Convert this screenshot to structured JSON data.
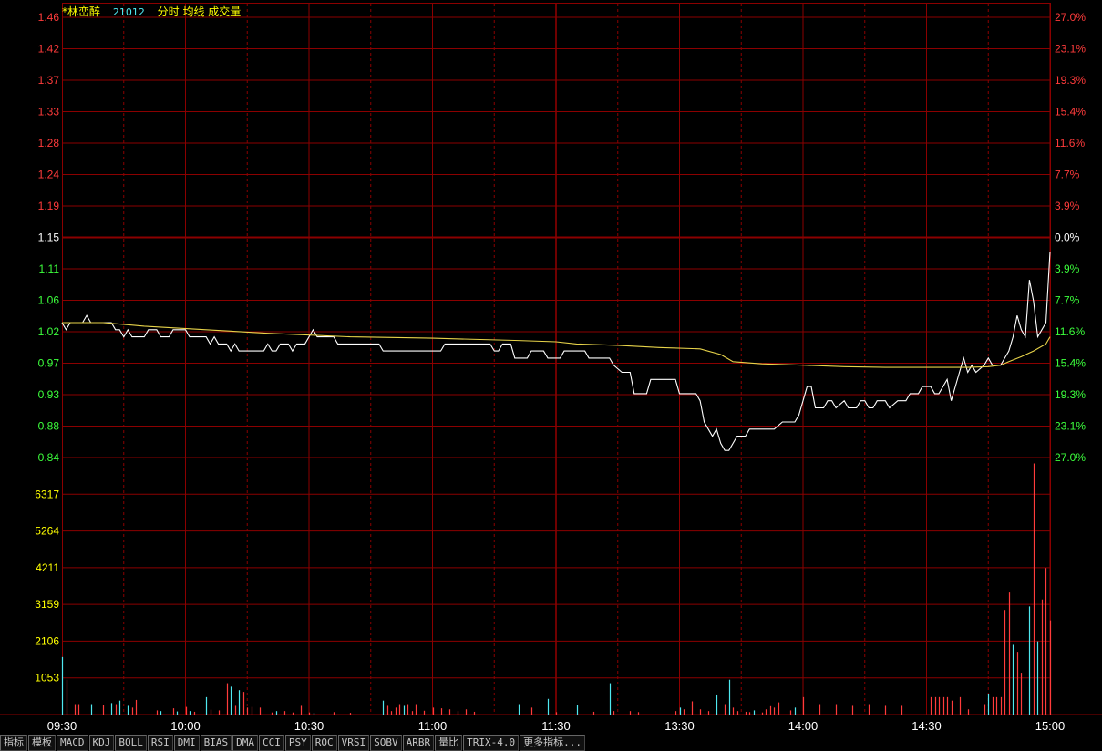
{
  "header": {
    "stock_name": "*林峦醉",
    "code": "21012",
    "modes": "分时 均线 成交量"
  },
  "colors": {
    "background": "#000000",
    "grid": "#8b0000",
    "price_line": "#ffffff",
    "avg_line": "#e8d44a",
    "up": "#ff3b3b",
    "down": "#3cff3c",
    "neutral": "#ffffff",
    "volume_up": "#ff3b3b",
    "volume_down": "#4fe8f0",
    "volume_axis": "#ffff00",
    "time_axis": "#ffffff"
  },
  "tabs": [
    "指标",
    "模板",
    "MACD",
    "KDJ",
    "BOLL",
    "RSI",
    "DMI",
    "BIAS",
    "DMA",
    "CCI",
    "PSY",
    "ROC",
    "VRSI",
    "SOBV",
    "ARBR",
    "量比",
    "TRIX-4.0",
    "更多指标..."
  ],
  "chart_data": {
    "type": "line",
    "title": "",
    "price_ticks": [
      "1.46",
      "1.42",
      "1.37",
      "1.33",
      "1.28",
      "1.24",
      "1.19",
      "1.15",
      "1.11",
      "1.06",
      "1.02",
      "0.97",
      "0.93",
      "0.88",
      "0.84"
    ],
    "pct_ticks": [
      "27.0%",
      "23.1%",
      "19.3%",
      "15.4%",
      "11.6%",
      "7.7%",
      "3.9%",
      "0.0%",
      "3.9%",
      "7.7%",
      "11.6%",
      "15.4%",
      "19.3%",
      "23.1%",
      "27.0%"
    ],
    "reference_price": 1.15,
    "ylim": [
      0.84,
      1.46
    ],
    "volume_ticks": [
      "6317",
      "5264",
      "4211",
      "3159",
      "2106",
      "1053"
    ],
    "volume_max": 7370,
    "time_labels": [
      "09:30",
      "10:00",
      "10:30",
      "11:00",
      "11:30",
      "13:30",
      "14:00",
      "14:30",
      "15:00"
    ],
    "minutes_total": 240,
    "series": [
      {
        "key": "price",
        "points": [
          [
            0,
            1.03
          ],
          [
            1,
            1.02
          ],
          [
            2,
            1.03
          ],
          [
            5,
            1.03
          ],
          [
            6,
            1.04
          ],
          [
            7,
            1.03
          ],
          [
            12,
            1.03
          ],
          [
            13,
            1.02
          ],
          [
            14,
            1.02
          ],
          [
            15,
            1.01
          ],
          [
            16,
            1.02
          ],
          [
            17,
            1.01
          ],
          [
            18,
            1.01
          ],
          [
            20,
            1.01
          ],
          [
            21,
            1.02
          ],
          [
            23,
            1.02
          ],
          [
            24,
            1.01
          ],
          [
            26,
            1.01
          ],
          [
            27,
            1.02
          ],
          [
            30,
            1.02
          ],
          [
            31,
            1.01
          ],
          [
            35,
            1.01
          ],
          [
            36,
            1.0
          ],
          [
            37,
            1.01
          ],
          [
            38,
            1.0
          ],
          [
            40,
            1.0
          ],
          [
            41,
            0.99
          ],
          [
            42,
            1.0
          ],
          [
            43,
            0.99
          ],
          [
            49,
            0.99
          ],
          [
            50,
            1.0
          ],
          [
            51,
            0.99
          ],
          [
            52,
            0.99
          ],
          [
            53,
            1.0
          ],
          [
            55,
            1.0
          ],
          [
            56,
            0.99
          ],
          [
            57,
            1.0
          ],
          [
            59,
            1.0
          ],
          [
            60,
            1.01
          ],
          [
            61,
            1.02
          ],
          [
            62,
            1.01
          ],
          [
            66,
            1.01
          ],
          [
            67,
            1.0
          ],
          [
            77,
            1.0
          ],
          [
            78,
            0.99
          ],
          [
            92,
            0.99
          ],
          [
            93,
            1.0
          ],
          [
            104,
            1.0
          ],
          [
            105,
            0.99
          ],
          [
            106,
            0.99
          ],
          [
            107,
            1.0
          ],
          [
            109,
            1.0
          ],
          [
            110,
            0.98
          ],
          [
            113,
            0.98
          ],
          [
            114,
            0.99
          ],
          [
            117,
            0.99
          ],
          [
            118,
            0.98
          ],
          [
            121,
            0.98
          ],
          [
            122,
            0.99
          ],
          [
            127,
            0.99
          ],
          [
            128,
            0.98
          ],
          [
            133,
            0.98
          ],
          [
            134,
            0.97
          ],
          [
            136,
            0.96
          ],
          [
            138,
            0.96
          ],
          [
            139,
            0.93
          ],
          [
            142,
            0.93
          ],
          [
            143,
            0.95
          ],
          [
            149,
            0.95
          ],
          [
            150,
            0.93
          ],
          [
            152,
            0.93
          ],
          [
            154,
            0.93
          ],
          [
            155,
            0.92
          ],
          [
            156,
            0.89
          ],
          [
            157,
            0.88
          ],
          [
            158,
            0.87
          ],
          [
            159,
            0.88
          ],
          [
            160,
            0.86
          ],
          [
            161,
            0.85
          ],
          [
            162,
            0.85
          ],
          [
            163,
            0.86
          ],
          [
            164,
            0.87
          ],
          [
            166,
            0.87
          ],
          [
            167,
            0.88
          ],
          [
            173,
            0.88
          ],
          [
            175,
            0.89
          ],
          [
            178,
            0.89
          ],
          [
            179,
            0.9
          ],
          [
            180,
            0.92
          ],
          [
            181,
            0.94
          ],
          [
            182,
            0.94
          ],
          [
            183,
            0.91
          ],
          [
            185,
            0.91
          ],
          [
            186,
            0.92
          ],
          [
            187,
            0.92
          ],
          [
            188,
            0.91
          ],
          [
            190,
            0.92
          ],
          [
            191,
            0.91
          ],
          [
            193,
            0.91
          ],
          [
            194,
            0.92
          ],
          [
            195,
            0.92
          ],
          [
            196,
            0.91
          ],
          [
            197,
            0.91
          ],
          [
            198,
            0.92
          ],
          [
            200,
            0.92
          ],
          [
            201,
            0.91
          ],
          [
            203,
            0.92
          ],
          [
            205,
            0.92
          ],
          [
            206,
            0.93
          ],
          [
            208,
            0.93
          ],
          [
            209,
            0.94
          ],
          [
            211,
            0.94
          ],
          [
            212,
            0.93
          ],
          [
            213,
            0.93
          ],
          [
            214,
            0.94
          ],
          [
            215,
            0.95
          ],
          [
            216,
            0.92
          ],
          [
            217,
            0.94
          ],
          [
            218,
            0.96
          ],
          [
            219,
            0.98
          ],
          [
            220,
            0.96
          ],
          [
            221,
            0.97
          ],
          [
            222,
            0.96
          ],
          [
            224,
            0.97
          ],
          [
            225,
            0.98
          ],
          [
            226,
            0.97
          ],
          [
            228,
            0.97
          ],
          [
            229,
            0.98
          ],
          [
            230,
            0.99
          ],
          [
            231,
            1.01
          ],
          [
            232,
            1.04
          ],
          [
            233,
            1.02
          ],
          [
            234,
            1.01
          ],
          [
            235,
            1.09
          ],
          [
            236,
            1.06
          ],
          [
            237,
            1.01
          ],
          [
            238,
            1.02
          ],
          [
            239,
            1.03
          ],
          [
            240,
            1.13
          ]
        ]
      },
      {
        "key": "average",
        "points": [
          [
            0,
            1.03
          ],
          [
            10,
            1.03
          ],
          [
            20,
            1.025
          ],
          [
            35,
            1.02
          ],
          [
            50,
            1.015
          ],
          [
            70,
            1.01
          ],
          [
            90,
            1.008
          ],
          [
            110,
            1.005
          ],
          [
            120,
            1.003
          ],
          [
            125,
            1.0
          ],
          [
            135,
            0.998
          ],
          [
            145,
            0.995
          ],
          [
            155,
            0.993
          ],
          [
            160,
            0.985
          ],
          [
            163,
            0.975
          ],
          [
            170,
            0.972
          ],
          [
            180,
            0.97
          ],
          [
            190,
            0.968
          ],
          [
            200,
            0.967
          ],
          [
            210,
            0.967
          ],
          [
            220,
            0.967
          ],
          [
            225,
            0.968
          ],
          [
            228,
            0.97
          ],
          [
            230,
            0.975
          ],
          [
            233,
            0.982
          ],
          [
            236,
            0.99
          ],
          [
            239,
            1.0
          ],
          [
            240,
            1.01
          ]
        ]
      }
    ],
    "volume": [
      [
        0,
        1650,
        "d"
      ],
      [
        1,
        1000,
        "u"
      ],
      [
        3,
        300,
        "u"
      ],
      [
        4,
        300,
        "u"
      ],
      [
        7,
        300,
        "d"
      ],
      [
        10,
        280,
        "u"
      ],
      [
        12,
        330,
        "d"
      ],
      [
        13,
        300,
        "u"
      ],
      [
        14,
        400,
        "d"
      ],
      [
        16,
        250,
        "d"
      ],
      [
        17,
        200,
        "u"
      ],
      [
        18,
        420,
        "u"
      ],
      [
        23,
        120,
        "u"
      ],
      [
        24,
        100,
        "d"
      ],
      [
        27,
        180,
        "u"
      ],
      [
        28,
        90,
        "d"
      ],
      [
        30,
        220,
        "u"
      ],
      [
        31,
        100,
        "d"
      ],
      [
        32,
        80,
        "u"
      ],
      [
        35,
        500,
        "d"
      ],
      [
        36,
        140,
        "u"
      ],
      [
        38,
        120,
        "u"
      ],
      [
        40,
        900,
        "u"
      ],
      [
        41,
        800,
        "d"
      ],
      [
        42,
        250,
        "u"
      ],
      [
        43,
        700,
        "d"
      ],
      [
        44,
        650,
        "u"
      ],
      [
        45,
        200,
        "u"
      ],
      [
        46,
        220,
        "u"
      ],
      [
        48,
        200,
        "u"
      ],
      [
        51,
        60,
        "u"
      ],
      [
        52,
        100,
        "d"
      ],
      [
        54,
        100,
        "u"
      ],
      [
        56,
        60,
        "u"
      ],
      [
        58,
        250,
        "u"
      ],
      [
        60,
        60,
        "u"
      ],
      [
        61,
        50,
        "d"
      ],
      [
        66,
        70,
        "u"
      ],
      [
        70,
        50,
        "u"
      ],
      [
        78,
        400,
        "d"
      ],
      [
        79,
        250,
        "u"
      ],
      [
        80,
        100,
        "u"
      ],
      [
        81,
        200,
        "u"
      ],
      [
        82,
        300,
        "u"
      ],
      [
        83,
        250,
        "d"
      ],
      [
        84,
        300,
        "u"
      ],
      [
        85,
        100,
        "u"
      ],
      [
        86,
        300,
        "u"
      ],
      [
        88,
        110,
        "u"
      ],
      [
        90,
        200,
        "u"
      ],
      [
        92,
        180,
        "u"
      ],
      [
        94,
        150,
        "u"
      ],
      [
        96,
        100,
        "u"
      ],
      [
        98,
        150,
        "u"
      ],
      [
        100,
        80,
        "u"
      ],
      [
        111,
        300,
        "d"
      ],
      [
        114,
        200,
        "u"
      ],
      [
        118,
        450,
        "d"
      ],
      [
        120,
        70,
        "u"
      ],
      [
        125,
        280,
        "d"
      ],
      [
        129,
        80,
        "u"
      ],
      [
        133,
        900,
        "d"
      ],
      [
        134,
        100,
        "u"
      ],
      [
        138,
        100,
        "u"
      ],
      [
        140,
        70,
        "u"
      ],
      [
        149,
        100,
        "u"
      ],
      [
        150,
        200,
        "d"
      ],
      [
        151,
        150,
        "u"
      ],
      [
        153,
        380,
        "u"
      ],
      [
        155,
        150,
        "u"
      ],
      [
        157,
        100,
        "u"
      ],
      [
        159,
        550,
        "d"
      ],
      [
        161,
        300,
        "u"
      ],
      [
        162,
        1000,
        "d"
      ],
      [
        163,
        200,
        "u"
      ],
      [
        164,
        100,
        "u"
      ],
      [
        166,
        80,
        "u"
      ],
      [
        167,
        70,
        "u"
      ],
      [
        168,
        120,
        "d"
      ],
      [
        170,
        60,
        "u"
      ],
      [
        171,
        150,
        "u"
      ],
      [
        172,
        240,
        "u"
      ],
      [
        173,
        200,
        "u"
      ],
      [
        174,
        350,
        "u"
      ],
      [
        177,
        120,
        "u"
      ],
      [
        178,
        200,
        "d"
      ],
      [
        180,
        500,
        "u"
      ],
      [
        184,
        300,
        "u"
      ],
      [
        188,
        300,
        "u"
      ],
      [
        192,
        250,
        "u"
      ],
      [
        196,
        300,
        "u"
      ],
      [
        200,
        250,
        "u"
      ],
      [
        204,
        250,
        "u"
      ],
      [
        211,
        500,
        "u"
      ],
      [
        212,
        500,
        "u"
      ],
      [
        213,
        500,
        "u"
      ],
      [
        214,
        500,
        "u"
      ],
      [
        215,
        500,
        "u"
      ],
      [
        216,
        400,
        "u"
      ],
      [
        218,
        500,
        "u"
      ],
      [
        220,
        150,
        "u"
      ],
      [
        224,
        300,
        "u"
      ],
      [
        225,
        600,
        "d"
      ],
      [
        226,
        500,
        "u"
      ],
      [
        227,
        500,
        "u"
      ],
      [
        228,
        500,
        "u"
      ],
      [
        229,
        3000,
        "u"
      ],
      [
        230,
        3500,
        "u"
      ],
      [
        231,
        2000,
        "d"
      ],
      [
        232,
        1800,
        "u"
      ],
      [
        233,
        1200,
        "u"
      ],
      [
        235,
        3100,
        "d"
      ],
      [
        236,
        7200,
        "u"
      ],
      [
        237,
        2100,
        "d"
      ],
      [
        238,
        3300,
        "u"
      ],
      [
        239,
        4200,
        "u"
      ],
      [
        240,
        2700,
        "u"
      ]
    ]
  }
}
